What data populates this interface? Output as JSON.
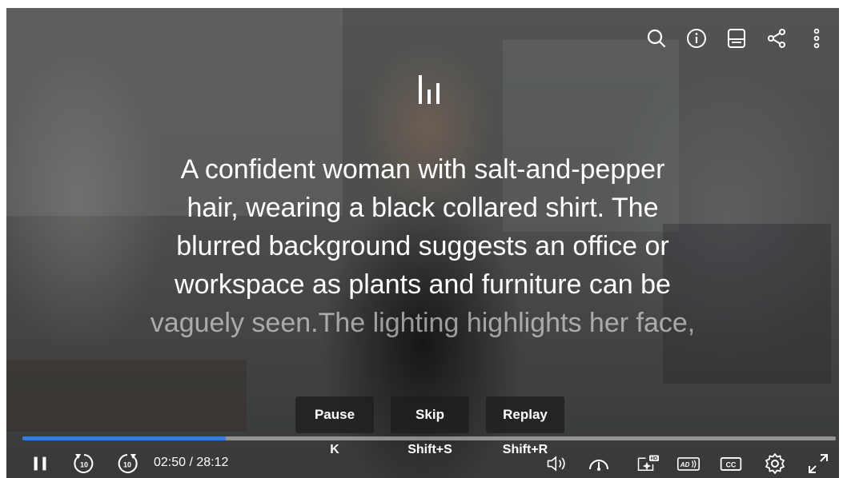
{
  "top_bar": {
    "icons": [
      "search-icon",
      "info-icon",
      "transcript-icon",
      "share-icon",
      "more-icon"
    ]
  },
  "audio_description": {
    "lines": [
      "A confident woman with salt-and-pepper",
      "hair, wearing a black collared shirt. The",
      "blurred background suggests an office or",
      "workspace as plants and furniture can be",
      "vaguely seen.The lighting highlights her face,"
    ]
  },
  "actions": {
    "pause": {
      "label": "Pause",
      "shortcut": "K"
    },
    "skip": {
      "label": "Skip",
      "shortcut": "Shift+S"
    },
    "replay": {
      "label": "Replay",
      "shortcut": "Shift+R"
    }
  },
  "playback": {
    "current_time": "02:50",
    "duration": "28:12",
    "time_display": "02:50 / 28:12",
    "progress_fraction": 0.25,
    "rewind_seconds": "10",
    "forward_seconds": "10",
    "hd_badge": "HD",
    "ad_label": "AD",
    "cc_label": "CC"
  },
  "colors": {
    "progress": "#2f7de1",
    "button_bg": "#1e1e1e"
  }
}
